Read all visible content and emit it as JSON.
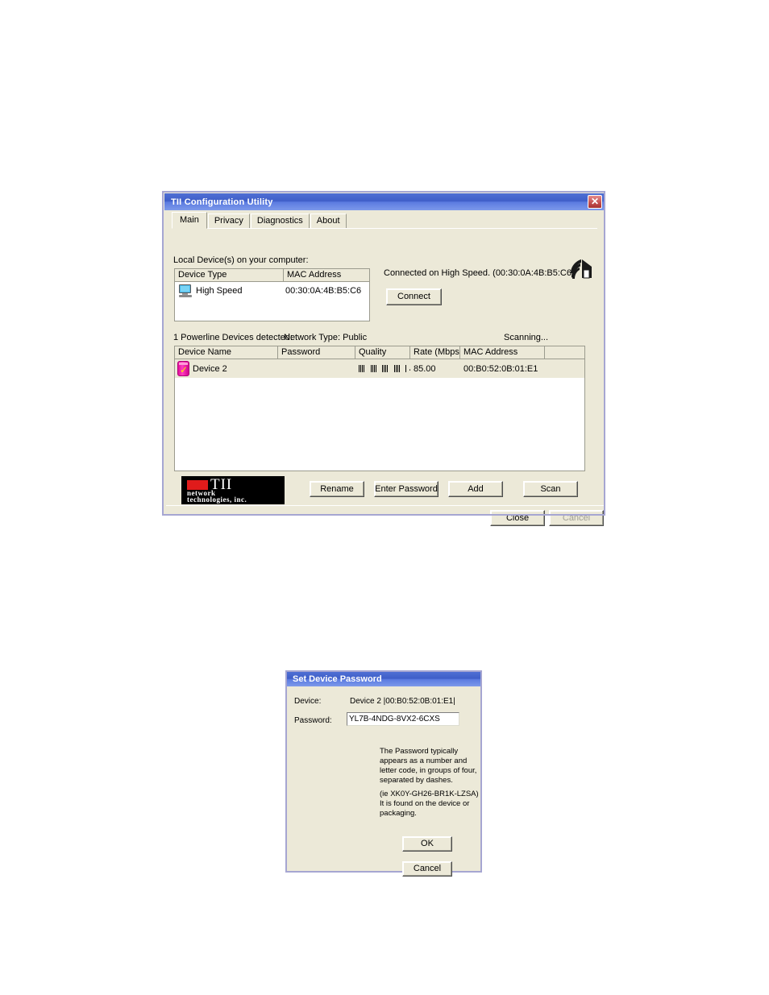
{
  "main_window": {
    "title": "TII Configuration Utility",
    "close_icon": "close-icon",
    "tabs": [
      {
        "label": "Main",
        "active": true
      },
      {
        "label": "Privacy",
        "active": false
      },
      {
        "label": "Diagnostics",
        "active": false
      },
      {
        "label": "About",
        "active": false
      }
    ],
    "local_devices": {
      "label": "Local Device(s) on your computer:",
      "columns": [
        "Device Type",
        "MAC Address"
      ],
      "rows": [
        {
          "icon": "monitor-icon",
          "device_type": "High Speed",
          "mac_address": "00:30:0A:4B:B5:C6"
        }
      ]
    },
    "connection": {
      "status": "Connected on  High Speed. (00:30:0A:4B:B5:C6)",
      "connect_label": "Connect",
      "house_icon": "house-signal-icon"
    },
    "powerline": {
      "detected_text": "1 Powerline Devices detected:",
      "network_type": "Network Type: Public",
      "scan_status": "Scanning...",
      "columns": [
        "Device Name",
        "Password",
        "Quality",
        "Rate (Mbps)",
        "MAC Address",
        ""
      ],
      "rows": [
        {
          "icon": "powerline-device-icon",
          "device_name": "Device 2",
          "password": "",
          "quality": "||||||||||||||||||...",
          "quality_bars": 17,
          "rate": "85.00",
          "mac_address": "00:B0:52:0B:01:E1"
        }
      ]
    },
    "logo": {
      "brand": "TII",
      "line2": "network",
      "line3": "technologies, inc."
    },
    "action_buttons": {
      "rename": "Rename",
      "enter_password": "Enter Password",
      "add": "Add",
      "scan": "Scan"
    },
    "footer_buttons": {
      "close": "Close",
      "cancel": "Cancel",
      "cancel_disabled": true
    }
  },
  "password_dialog": {
    "title": "Set Device Password",
    "device_label": "Device:",
    "device_value": "Device 2  |00:B0:52:0B:01:E1|",
    "password_label": "Password:",
    "password_value": "YL7B-4NDG-8VX2-6CXS",
    "help_text": "The Password typically appears as a number and letter code, in groups of four, separated by dashes.",
    "help_text_2": "(ie XK0Y-GH26-BR1K-LZSA) It is found on the device or packaging.",
    "ok_label": "OK",
    "cancel_label": "Cancel"
  },
  "colors": {
    "titlebar": "#4664c8",
    "window_face": "#ece9d8",
    "window_border": "#a6a6d2",
    "device_icon": "#e0119a",
    "logo_red": "#e01b1b"
  }
}
